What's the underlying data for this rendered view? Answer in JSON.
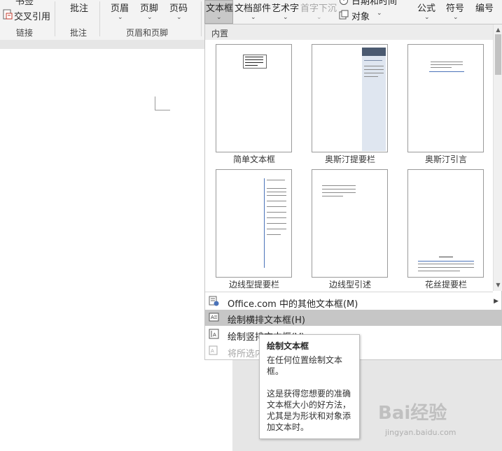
{
  "ribbon": {
    "bookmark_partial": "书签",
    "cross_ref": "交叉引用",
    "links_group": "链接",
    "comment": "批注",
    "comment_group": "批注",
    "header": "页眉",
    "footer": "页脚",
    "page_number": "页码",
    "header_footer_group": "页眉和页脚",
    "textbox": "文本框",
    "quick_parts": "文档部件",
    "wordart": "艺术字",
    "dropcap": "首字下沉",
    "datetime_partial": "日期和时间",
    "object": "对象",
    "equation": "公式",
    "symbol": "符号",
    "numbering": "编号"
  },
  "dropdown": {
    "section_header": "内置",
    "gallery": [
      {
        "label": "简单文本框"
      },
      {
        "label": "奥斯汀提要栏"
      },
      {
        "label": "奥斯汀引言"
      },
      {
        "label": "边线型提要栏"
      },
      {
        "label": "边线型引述"
      },
      {
        "label": "花丝提要栏"
      }
    ],
    "menu": {
      "more_office": "Office.com 中的其他文本框(M)",
      "draw_horizontal": "绘制横排文本框(H)",
      "draw_vertical_partial": "绘制竖排文本框(V)",
      "save_selection_partial": "将所选内容保存到文本框库(S)"
    }
  },
  "tooltip": {
    "title": "绘制文本框",
    "description": "在任何位置绘制文本框。",
    "detail": "这是获得您想要的准确文本框大小的好方法，尤其是为形状和对象添加文本时。"
  },
  "watermark": {
    "logo": "Bai经验",
    "url": "jingyan.baidu.com"
  },
  "colors": {
    "highlight": "#c6c6c6",
    "ribbon_bg": "#f3f3f3",
    "accent_blue": "#4a72b8"
  }
}
